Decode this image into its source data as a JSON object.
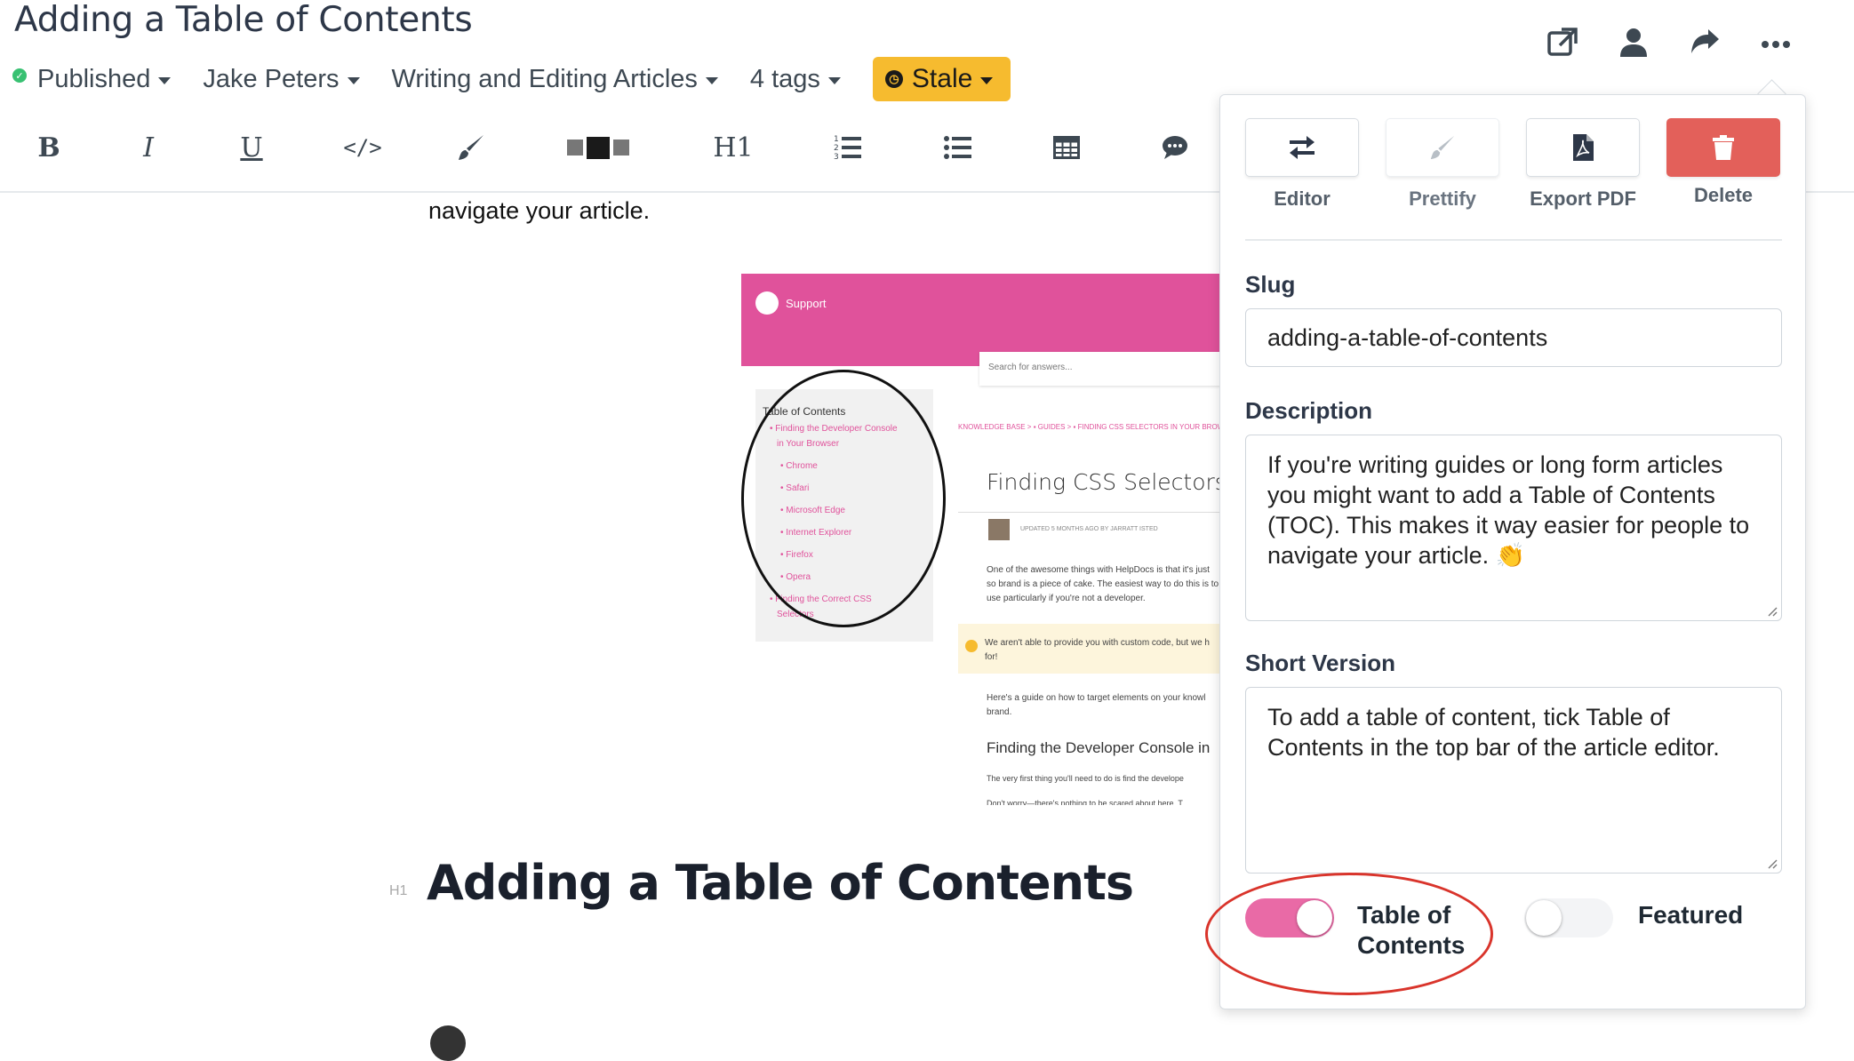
{
  "header": {
    "article_title": "Adding a Table of Contents",
    "status": "Published",
    "author": "Jake Peters",
    "category": "Writing and Editing Articles",
    "tags": "4 tags",
    "stale_label": "Stale"
  },
  "toolbar": {
    "bold": "B",
    "italic": "I",
    "underline": "U",
    "code": "</>",
    "heading": "H1"
  },
  "editor": {
    "intro_tail": "navigate your article.",
    "heading_badge": "H1",
    "heading": "Adding a Table of Contents"
  },
  "screenshot": {
    "brand": "Support",
    "search_placeholder": "Search for answers...",
    "toc_title": "Table of Contents",
    "toc_items": [
      "• Finding the Developer Console",
      "  in Your Browser",
      "• Chrome",
      "• Safari",
      "• Microsoft Edge",
      "• Internet Explorer",
      "• Firefox",
      "• Opera",
      "• Finding the Correct CSS",
      "  Selectors"
    ],
    "breadcrumb": "KNOWLEDGE BASE > ▪ GUIDES > ▪ FINDING CSS SELECTORS IN YOUR BROWSER",
    "article_heading": "Finding CSS Selectors in",
    "updated": "UPDATED 5 MONTHS AGO BY JARRATT ISTED",
    "para1": "One of the awesome things with HelpDocs is that it's just so brand is a piece of cake. The easiest way to do this is to use particularly if you're not a developer.",
    "alert": "We aren't able to provide you with custom code, but we h for!",
    "para2": "Here's a guide on how to target elements on your knowl brand.",
    "heading2": "Finding the Developer Console in",
    "para3a": "The very first thing you'll need to do is find the develope",
    "para3b": "Don't worry—there's nothing to be scared about here. T"
  },
  "panel": {
    "actions": [
      {
        "label": "Editor",
        "icon": "swap-arrows-icon"
      },
      {
        "label": "Prettify",
        "icon": "brush-icon"
      },
      {
        "label": "Export PDF",
        "icon": "pdf-file-icon"
      },
      {
        "label": "Delete",
        "icon": "trash-icon"
      }
    ],
    "slug_label": "Slug",
    "slug_value": "adding-a-table-of-contents",
    "description_label": "Description",
    "description_value": "If you're writing guides or long form articles you might want to add a Table of Contents (TOC). This makes it way easier for people to navigate your article. 👏",
    "short_label": "Short Version",
    "short_value": "To add a table of content, tick Table of Contents in the top bar of the article editor.",
    "toc_toggle_label": "Table of Contents",
    "toc_toggle_on": true,
    "featured_toggle_label": "Featured",
    "featured_toggle_on": false
  },
  "colors": {
    "stale": "#f6bb2f",
    "delete": "#e3605a",
    "toggle_on": "#e96aa6",
    "brand_pink": "#e0529b",
    "annotation_red": "#d9342b"
  }
}
